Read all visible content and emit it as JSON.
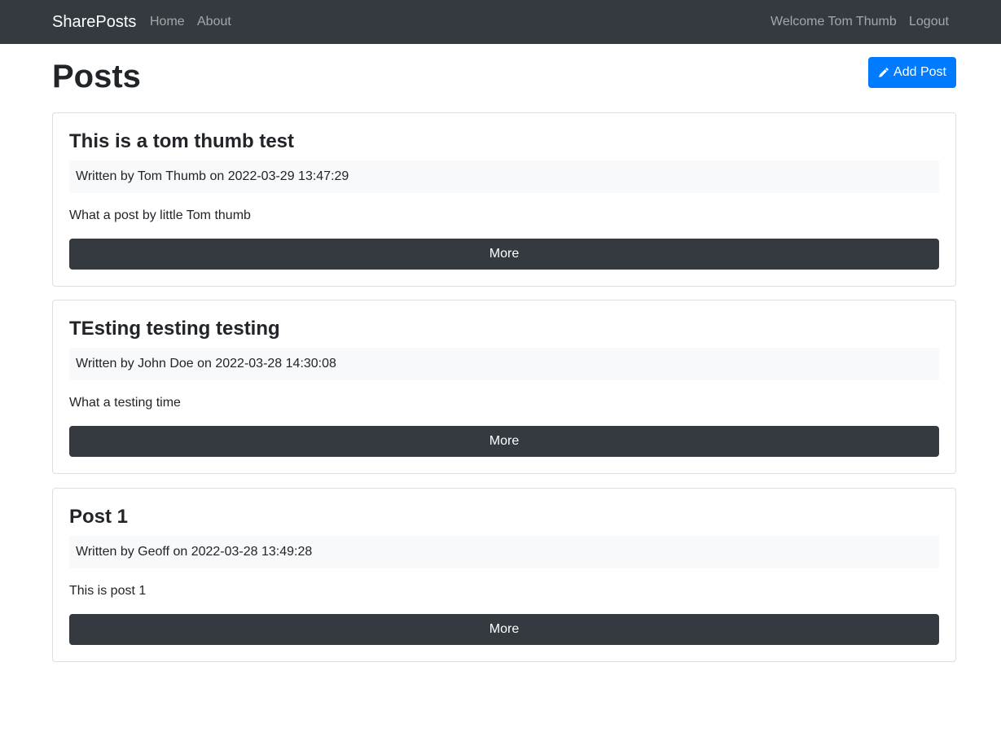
{
  "navbar": {
    "brand": "SharePosts",
    "links": [
      {
        "label": "Home"
      },
      {
        "label": "About"
      }
    ],
    "welcome": "Welcome Tom Thumb",
    "logout": "Logout"
  },
  "page": {
    "title": "Posts",
    "add_post_label": "Add Post",
    "add_post_icon": "pencil-icon"
  },
  "posts": [
    {
      "title": "This is a tom thumb test",
      "meta": "Written by Tom Thumb on 2022-03-29 13:47:29",
      "body": "What a post by little Tom thumb",
      "more_label": "More"
    },
    {
      "title": "TEsting testing testing",
      "meta": "Written by John Doe on 2022-03-28 14:30:08",
      "body": "What a testing time",
      "more_label": "More"
    },
    {
      "title": "Post 1",
      "meta": "Written by Geoff on 2022-03-28 13:49:28",
      "body": "This is post 1",
      "more_label": "More"
    }
  ],
  "colors": {
    "navbar_bg": "#343a40",
    "primary": "#007bff",
    "dark_button": "#343a40",
    "meta_bg": "#f8f9fa"
  }
}
